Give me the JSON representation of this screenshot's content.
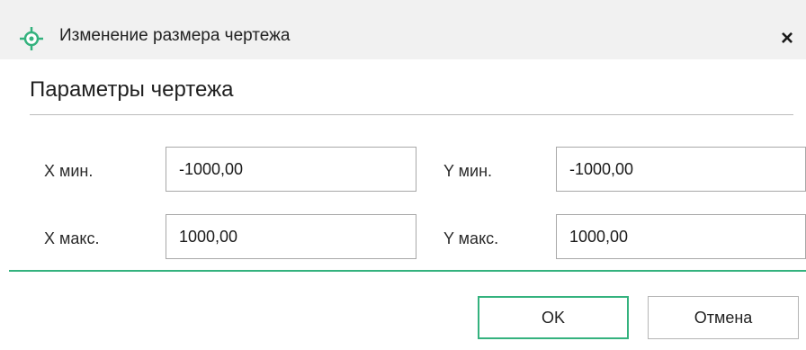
{
  "window": {
    "title": "Изменение размера чертежа",
    "close_symbol": "×",
    "icon": "crosshair-target-icon",
    "accent_color": "#34b27e"
  },
  "section": {
    "title": "Параметры чертежа"
  },
  "fields": {
    "x_min": {
      "label": "X мин.",
      "value": "-1000,00"
    },
    "x_max": {
      "label": "X макс.",
      "value": "1000,00"
    },
    "y_min": {
      "label": "Y мин.",
      "value": "-1000,00"
    },
    "y_max": {
      "label": "Y макс.",
      "value": "1000,00"
    }
  },
  "buttons": {
    "ok_label": "OK",
    "cancel_label": "Отмена"
  }
}
